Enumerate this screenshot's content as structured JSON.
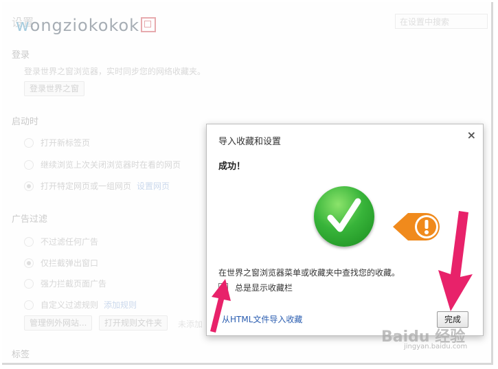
{
  "page": {
    "title": "设置",
    "search_placeholder": "在设置中搜索",
    "logo_text": "wongziokokok"
  },
  "sections": {
    "login": {
      "heading": "登录",
      "desc": "登录世界之窗浏览器，实时同步您的网络收藏夹。",
      "button": "登录世界之窗"
    },
    "startup": {
      "heading": "启动时",
      "options": [
        {
          "label": "打开新标签页"
        },
        {
          "label": "继续浏览上次关闭浏览器时在看的网页"
        },
        {
          "label": "打开特定网页或一组网页",
          "link": "设置网页"
        }
      ]
    },
    "adblock": {
      "heading": "广告过滤",
      "options": [
        {
          "label": "不过滤任何广告"
        },
        {
          "label": "仅拦截弹出窗口"
        },
        {
          "label": "强力拦截页面广告"
        },
        {
          "label": "自定义过滤规则",
          "link": "添加规则"
        }
      ],
      "btn_exceptions": "管理例外网站...",
      "btn_rules": "打开规则文件夹",
      "trailing": "未添加"
    },
    "tags": {
      "heading": "标签"
    }
  },
  "dialog": {
    "title": "导入收藏和设置",
    "close": "×",
    "success": "成功！",
    "info": "在世界之窗浏览器菜单或收藏夹中查找您的收藏。",
    "checkbox_label": "总是显示收藏栏",
    "checkbox_checked": true,
    "import_link": "从HTML文件导入收藏",
    "done": "完成"
  },
  "watermark": {
    "main": "Baidu 经验",
    "sub": "jingyan.baidu.com"
  },
  "colors": {
    "accent_green": "#38b43a",
    "arrow_pink": "#e8226a",
    "warn_orange": "#f08a1c"
  }
}
